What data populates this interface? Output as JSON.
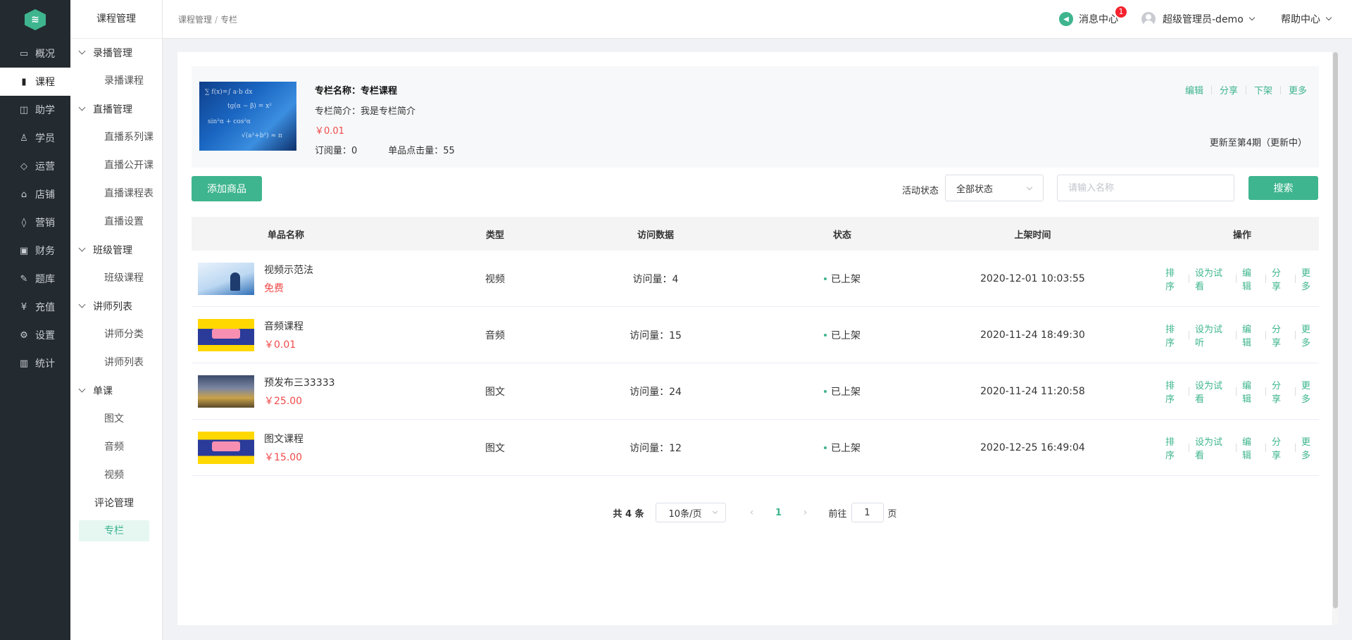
{
  "nav": {
    "logo_icon": "logo-icon",
    "items": [
      {
        "label": "概况",
        "icon": "monitor-icon"
      },
      {
        "label": "课程",
        "icon": "book-icon"
      },
      {
        "label": "助学",
        "icon": "briefcase-icon"
      },
      {
        "label": "学员",
        "icon": "user-icon"
      },
      {
        "label": "运营",
        "icon": "cube-icon"
      },
      {
        "label": "店铺",
        "icon": "store-icon"
      },
      {
        "label": "营销",
        "icon": "tag-icon"
      },
      {
        "label": "财务",
        "icon": "wallet-icon"
      },
      {
        "label": "题库",
        "icon": "pen-icon"
      },
      {
        "label": "充值",
        "icon": "yen-icon"
      },
      {
        "label": "设置",
        "icon": "gear-icon"
      },
      {
        "label": "统计",
        "icon": "bar-chart-icon"
      }
    ]
  },
  "sub": {
    "title": "课程管理",
    "groups": [
      {
        "label": "录播管理",
        "items": [
          "录播课程"
        ]
      },
      {
        "label": "直播管理",
        "items": [
          "直播系列课",
          "直播公开课",
          "直播课程表",
          "直播设置"
        ]
      },
      {
        "label": "班级管理",
        "items": [
          "班级课程"
        ]
      },
      {
        "label": "讲师列表",
        "items": [
          "讲师分类",
          "讲师列表"
        ]
      },
      {
        "label": "单课",
        "items": [
          "图文",
          "音频",
          "视频"
        ]
      }
    ],
    "comment": "评论管理",
    "active": "专栏"
  },
  "header": {
    "breadcrumb": [
      "课程管理",
      "/",
      "专栏"
    ],
    "message": "消息中心",
    "message_badge": "1",
    "user": "超级管理员-demo",
    "help": "帮助中心"
  },
  "column": {
    "name_label": "专栏名称：",
    "name": "专栏课程",
    "desc_label": "专栏简介：",
    "desc": "我是专栏简介",
    "price": "￥0.01",
    "subs": "订阅量：0",
    "clicks": "单品点击量：55",
    "actions": [
      "编辑",
      "分享",
      "下架",
      "更多"
    ],
    "update": "更新至第4期（更新中）"
  },
  "toolbar": {
    "add": "添加商品",
    "filter_label": "活动状态",
    "filter_value": "全部状态",
    "search_placeholder": "请输入名称",
    "search": "搜索"
  },
  "table": {
    "headers": [
      "单品名称",
      "类型",
      "访问数据",
      "状态",
      "上架时间",
      "操作"
    ],
    "rows": [
      {
        "name": "视频示范法",
        "price": "免费",
        "type": "视频",
        "visits": "访问量：4",
        "status": "已上架",
        "time": "2020-12-01 10:03:55",
        "ops": [
          "排序",
          "设为试看",
          "编辑",
          "分享",
          "更多"
        ]
      },
      {
        "name": "音频课程",
        "price": "￥0.01",
        "type": "音频",
        "visits": "访问量：15",
        "status": "已上架",
        "time": "2020-11-24 18:49:30",
        "ops": [
          "排序",
          "设为试听",
          "编辑",
          "分享",
          "更多"
        ]
      },
      {
        "name": "预发布三33333",
        "price": "￥25.00",
        "type": "图文",
        "visits": "访问量：24",
        "status": "已上架",
        "time": "2020-11-24 11:20:58",
        "ops": [
          "排序",
          "设为试看",
          "编辑",
          "分享",
          "更多"
        ]
      },
      {
        "name": "图文课程",
        "price": "￥15.00",
        "type": "图文",
        "visits": "访问量：12",
        "status": "已上架",
        "time": "2020-12-25 16:49:04",
        "ops": [
          "排序",
          "设为试看",
          "编辑",
          "分享",
          "更多"
        ]
      }
    ]
  },
  "pager": {
    "total": "共 4 条",
    "size": "10条/页",
    "prev": "‹",
    "page": "1",
    "next": "›",
    "goto_prefix": "前往",
    "goto_value": "1",
    "goto_suffix": "页"
  },
  "colors": {
    "accent": "#3eb58e",
    "price": "#f04b4b",
    "nav_bg": "#232a30"
  }
}
